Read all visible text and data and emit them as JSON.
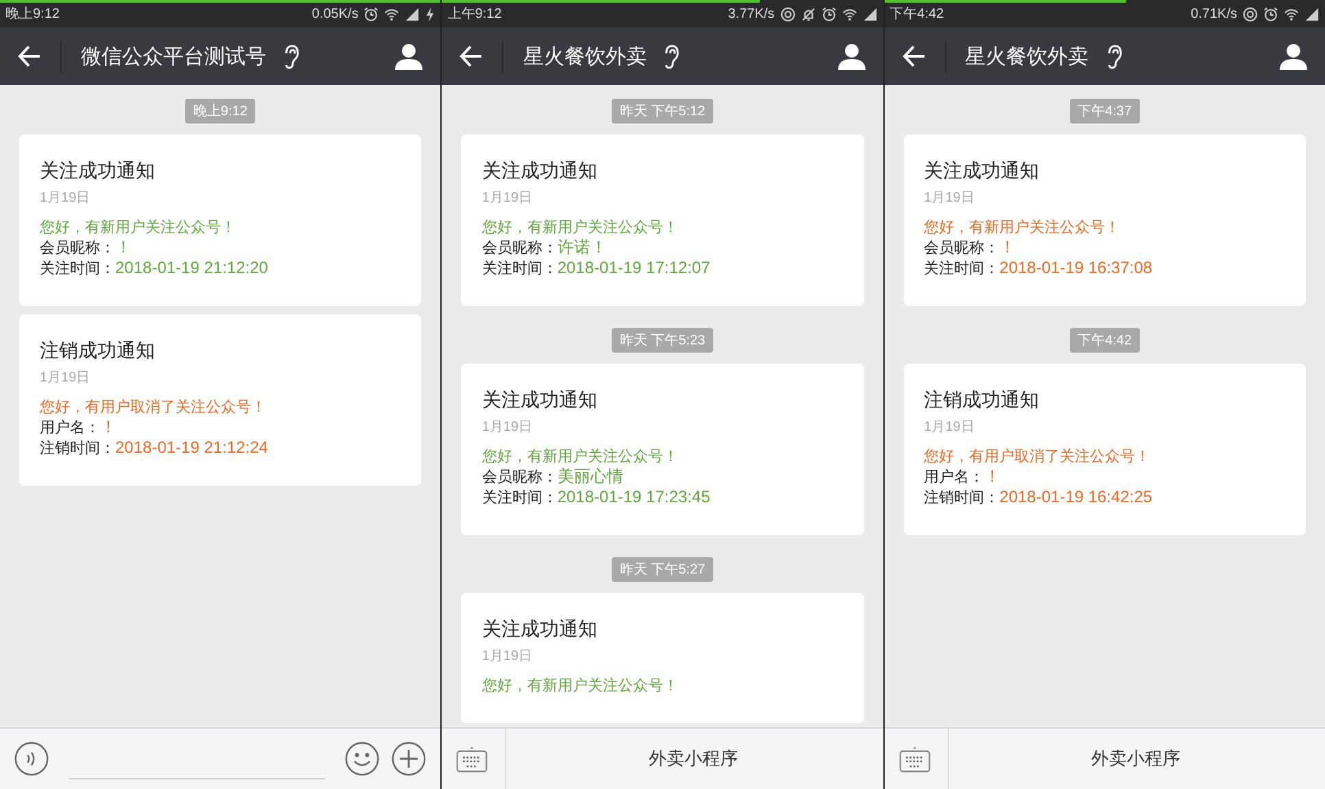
{
  "phones": [
    {
      "status_bar": {
        "time": "晚上9:12",
        "speed": "0.05K/s",
        "data_saver": false,
        "do_not_disturb": false,
        "charging": true
      },
      "loading": {
        "level": 1
      },
      "header": {
        "title": "微信公众平台测试号"
      },
      "messages": [
        {
          "time": "晚上9:12",
          "title": "关注成功通知",
          "date": "1月19日",
          "color": "#5fa83a",
          "greeting": "您好，有新用户关注公众号！",
          "fields": [
            {
              "label": "会员昵称：",
              "value": "！"
            },
            {
              "label": "关注时间：",
              "value": "2018-01-19 21:12:20"
            }
          ]
        },
        {
          "title": "注销成功通知",
          "date": "1月19日",
          "color": "#f0671e",
          "greeting": "您好，有用户取消了关注公众号！",
          "fields": [
            {
              "label": "用户名：",
              "value": "！"
            },
            {
              "label": "注销时间：",
              "value": "2018-01-19 21:12:24"
            }
          ]
        }
      ],
      "bottom_bar": {
        "kind": "input"
      }
    },
    {
      "status_bar": {
        "time": "上午9:12",
        "speed": "3.77K/s",
        "data_saver": true,
        "do_not_disturb": true,
        "charging": false
      },
      "loading": {
        "level": 0.72
      },
      "header": {
        "title": "星火餐饮外卖"
      },
      "messages": [
        {
          "time": "昨天 下午5:12",
          "title": "关注成功通知",
          "date": "1月19日",
          "color": "#5fa83a",
          "greeting": "您好，有新用户关注公众号！",
          "fields": [
            {
              "label": "会员昵称：",
              "value": "许诺！"
            },
            {
              "label": "关注时间：",
              "value": "2018-01-19 17:12:07"
            }
          ]
        },
        {
          "time": "昨天 下午5:23",
          "title": "关注成功通知",
          "date": "1月19日",
          "color": "#5fa83a",
          "greeting": "您好，有新用户关注公众号！",
          "fields": [
            {
              "label": "会员昵称：",
              "value": "美丽心情"
            },
            {
              "label": "关注时间：",
              "value": "2018-01-19 17:23:45"
            }
          ]
        },
        {
          "time": "昨天 下午5:27",
          "title": "关注成功通知",
          "date": "1月19日",
          "color": "#5fa83a",
          "greeting": "您好，有新用户关注公众号！"
        }
      ],
      "bottom_bar": {
        "kind": "menu",
        "menu_label": "外卖小程序"
      }
    },
    {
      "status_bar": {
        "time": "下午4:42",
        "speed": "0.71K/s",
        "data_saver": true,
        "do_not_disturb": false,
        "charging": false
      },
      "loading": {
        "level": 0.55
      },
      "header": {
        "title": "星火餐饮外卖"
      },
      "messages": [
        {
          "time": "下午4:37",
          "title": "关注成功通知",
          "date": "1月19日",
          "color": "#f0671e",
          "greeting": "您好，有新用户关注公众号！",
          "fields": [
            {
              "label": "会员昵称：",
              "value": "！"
            },
            {
              "label": "关注时间：",
              "value": "2018-01-19 16:37:08"
            }
          ]
        },
        {
          "time": "下午4:42",
          "title": "注销成功通知",
          "date": "1月19日",
          "color": "#f0671e",
          "greeting": "您好，有用户取消了关注公众号！",
          "fields": [
            {
              "label": "用户名：",
              "value": "！"
            },
            {
              "label": "注销时间：",
              "value": "2018-01-19 16:42:25"
            }
          ]
        }
      ],
      "bottom_bar": {
        "kind": "menu",
        "menu_label": "外卖小程序"
      }
    }
  ]
}
